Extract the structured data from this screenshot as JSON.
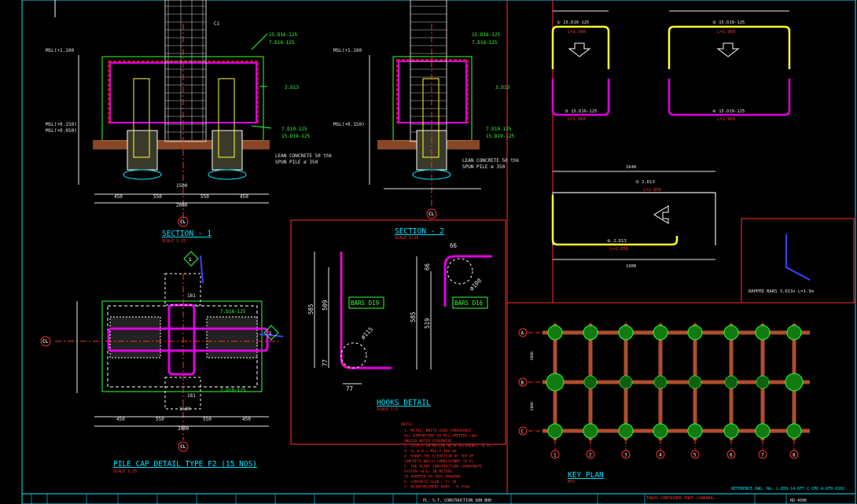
{
  "sections": {
    "section1": {
      "title": "SECTION - 1",
      "scale": "SCALE  1:25"
    },
    "section2": {
      "title": "SECTION - 2",
      "scale": "SCALE  1:25"
    },
    "pile_cap": {
      "title": "PILE CAP DETAIL TYPE F2 (15 NOS)",
      "scale": "SCALE  1:25"
    },
    "hooks": {
      "title": "HOOKS DETAIL",
      "scale": "SCALE  1:5"
    },
    "key_plan": {
      "title": "KEY PLAN",
      "scale": "NTS"
    }
  },
  "labels": {
    "cl": "CL",
    "c1": "C1",
    "msl_top": "MSL(+1.100",
    "msl_mid": "MSL(+0.150)",
    "msl_low": "MSL(+0.050)",
    "bar_15d16": "15.D16-125",
    "bar_7d16": "7.D16-125",
    "bar_2d13": "2.D13",
    "bar_3d13": "3.D13",
    "bar_7d19": "7.D19-125",
    "bar_15d19": "15.D19-125",
    "lean_concrete": "LEAN CONCRETE 50 thk",
    "spun_pile": "SPUN PILE ø 350",
    "bars_d19": "BARS D19",
    "bars_d16": "BARS D16",
    "hook_a_585": "585",
    "hook_a_509": "509",
    "hook_a_77a": "77",
    "hook_a_77b": "77",
    "hook_a_r": "ø115",
    "hook_b_66a": "66",
    "hook_b_66b": "66",
    "hook_b_585": "585",
    "hook_b_519": "519",
    "hook_b_r": "ø100",
    "dim_450a": "450",
    "dim_550a": "550",
    "dim_1500": "1500",
    "dim_550b": "550",
    "dim_450b": "450",
    "dim_2000": "2000",
    "dim_181a": "181",
    "dim_181b": "181",
    "sec_marker": "1",
    "lap_bars": "RAPPED BARS  3.D13x L=1.3m",
    "reference": "REFERENCE DWG. No.  L-856-14-DFT-C-CMC-A-DFD-0102",
    "project_title": "TANJU CONTAINER PORT (SANARA)",
    "footer_company": "PL. S.T. CONSTRUCTION SDN BHD",
    "footer_drg": "RD-4506"
  },
  "notes": {
    "header": "NOTES:",
    "lines": [
      "1. METRIC UNITS USED THROUGHOUT.",
      "   ALL DIMENSIONS IN MILLIMETERS (mm)",
      "   UNLESS NOTED OTHERWISE.",
      "2. LEVELS IN METERS WITH REFERENCE TO FL.",
      "3. FL 0.0 = MSL+2.500 mm.",
      "4. SHOWS THE ELEVATION OF TOP OF",
      "   CONCRETE WHICH CORRESPONDS TO FL.",
      "5. THE PLANT CONSTRUCTION COORDINATE",
      "   SYSTEM (N,E) IN METERS",
      "   IS ADOPTED IN THIS DRAWING.",
      "6. CONCRETE SLAB     : fc 30",
      "7. REINFORCEMENT BARS : D.fY40"
    ]
  },
  "bar_shapes": {
    "b1_label": "① 15.D16-125",
    "b1_len": "L=1.960",
    "b2_label": "② 15.D19-125",
    "b2_len": "L=1.960",
    "b3_label": "③ 15.D16-125",
    "b3_len": "L=1.960",
    "b4_label": "④ 15.D19-125",
    "b4_len": "L=1.960",
    "b5_label": "⑤ 2.D13",
    "b5_len": "L=2.850",
    "b6_label": "⑥ 2.D13",
    "b6_len": "L=2.850",
    "dim_1640": "1640",
    "dim_1900": "1900"
  },
  "key_plan": {
    "rows": [
      "A",
      "B",
      "C"
    ],
    "cols": [
      "1",
      "2",
      "3",
      "4",
      "5",
      "6",
      "7",
      "8"
    ],
    "dim_a": "6000",
    "dim_b": "6000"
  },
  "colors": {
    "background": "#000000",
    "frame": "#00e5ff",
    "section_lines": "#ff3030",
    "rebar": "#e000e0",
    "dims": "#e8e8e8",
    "leader": "#33ff33",
    "yellow_bar": "#ffff33"
  }
}
